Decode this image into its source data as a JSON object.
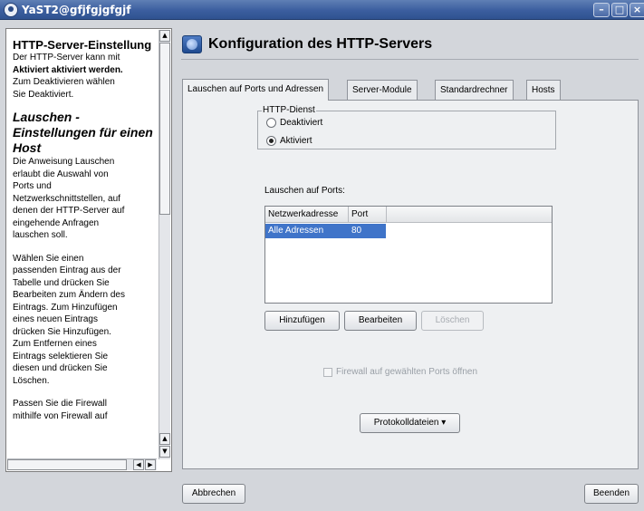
{
  "window": {
    "title": "YaST2@gfjfgjgfgjf",
    "controls": [
      "minimize",
      "maximize",
      "close"
    ]
  },
  "help": {
    "heading": "HTTP-Server-Einstellung",
    "p1": [
      "Der HTTP-Server kann mit",
      "Aktiviert aktiviert werden.",
      "Zum Deaktivieren wählen",
      "Sie Deaktiviert."
    ],
    "subheading": "Lauschen - Einstellungen für einen Host",
    "p2": [
      "Die Anweisung Lauschen",
      "erlaubt die Auswahl von",
      "Ports und",
      "Netzwerkschnittstellen, auf",
      "denen der HTTP-Server auf",
      "eingehende Anfragen",
      "lauschen soll."
    ],
    "p3": [
      "Wählen Sie einen",
      "passenden Eintrag aus der",
      "Tabelle und drücken Sie",
      "Bearbeiten zum Ändern des",
      "Eintrags. Zum Hinzufügen",
      "eines neuen Eintrags",
      "drücken Sie Hinzufügen.",
      "Zum Entfernen eines",
      "Eintrags selektieren Sie",
      "diesen und drücken Sie",
      "Löschen."
    ],
    "p4": [
      "Passen Sie die Firewall",
      "mithilfe von Firewall auf"
    ]
  },
  "module": {
    "title": "Konfiguration des HTTP-Servers",
    "icon": "web-server-icon"
  },
  "tabs": [
    "Lauschen auf Ports und Adressen",
    "Server-Module",
    "Standardrechner",
    "Hosts"
  ],
  "http_service": {
    "legend": "HTTP-Dienst",
    "options": [
      "Deaktiviert",
      "Aktiviert"
    ],
    "selected": "Aktiviert"
  },
  "ports": {
    "label": "Lauschen auf Ports:",
    "columns": [
      "Netzwerkadresse",
      "Port"
    ],
    "rows": [
      [
        "Alle Adressen",
        "80"
      ]
    ],
    "selected_row": 0
  },
  "buttons": {
    "add": "Hinzufügen",
    "edit": "Bearbeiten",
    "delete": "Löschen",
    "firewall": "Firewall auf gewählten Ports öffnen",
    "logs": "Protokolldateien",
    "cancel": "Abbrechen",
    "finish": "Beenden"
  },
  "colors": {
    "titlebar": "#3b5e9f",
    "selection": "#3f74c9",
    "panel": "#eef0f2",
    "background": "#d3d6db"
  }
}
